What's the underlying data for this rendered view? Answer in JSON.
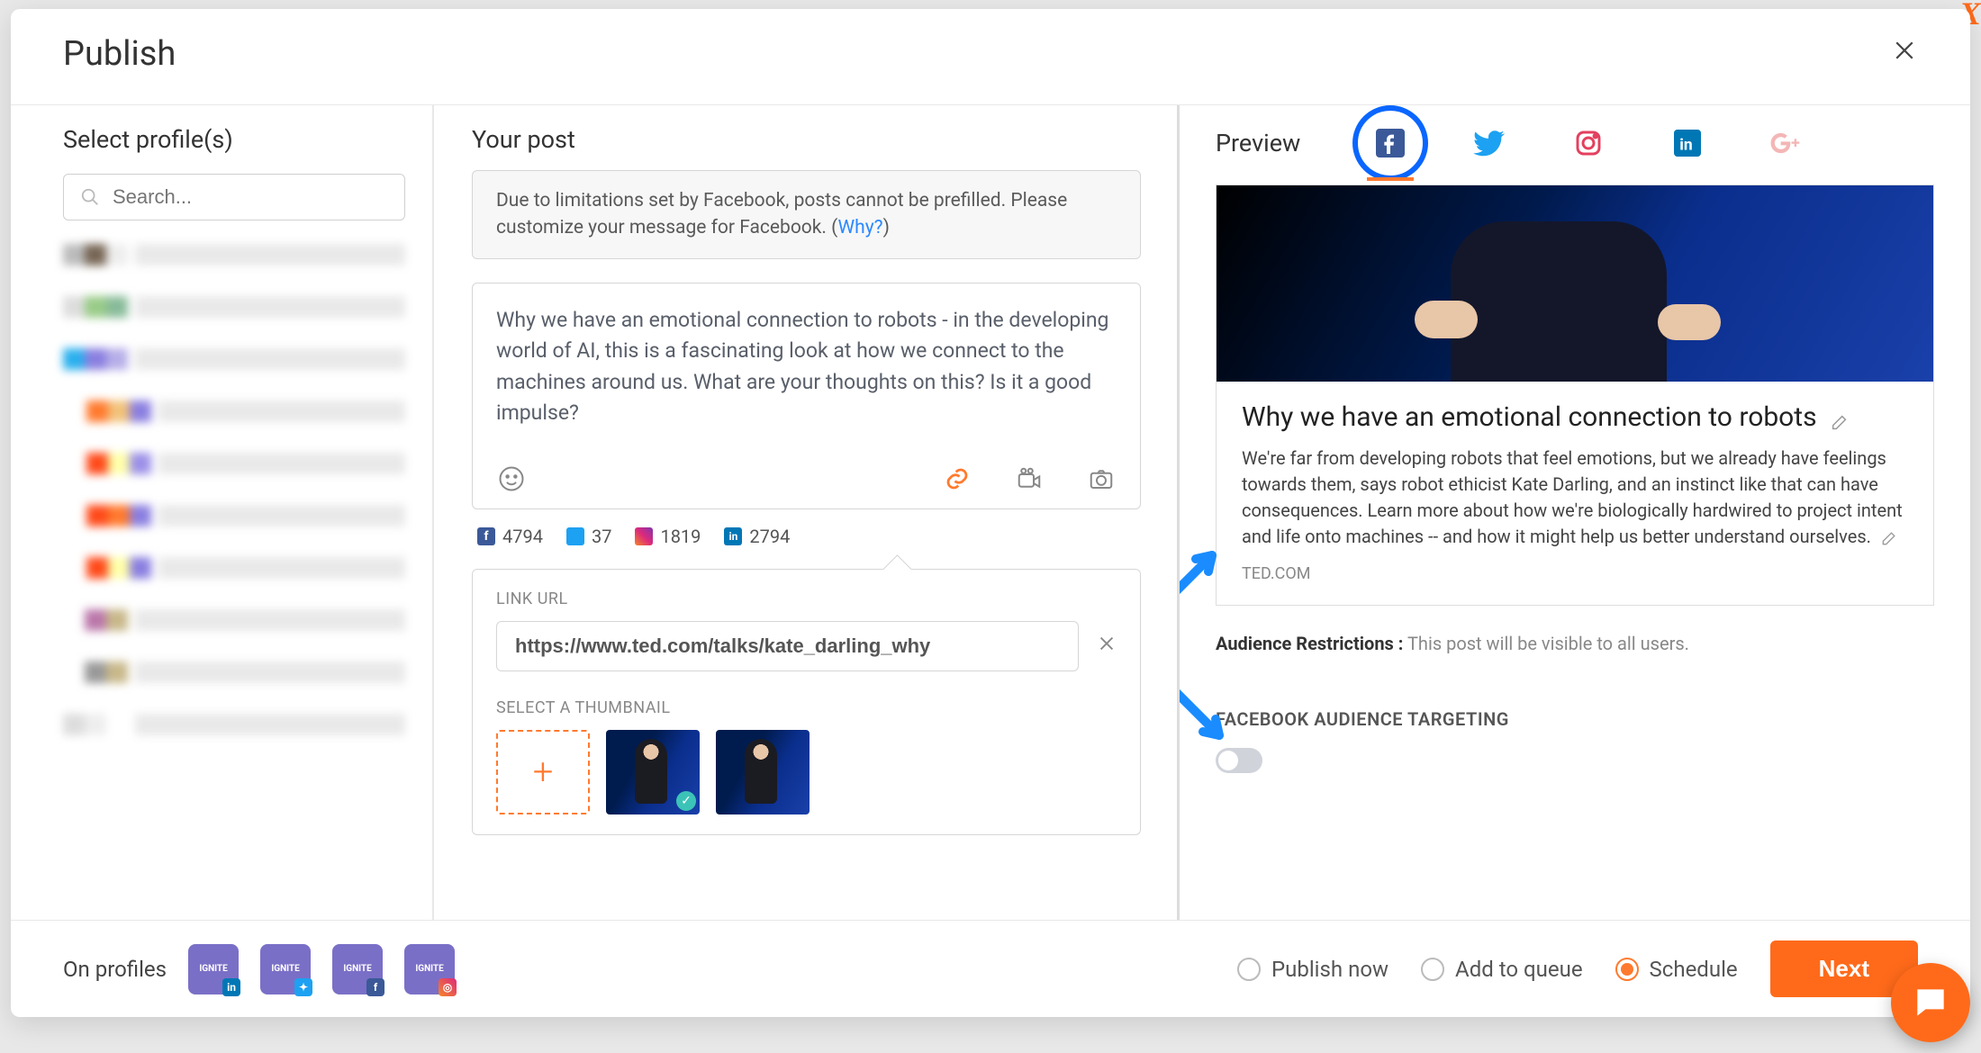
{
  "header": {
    "title": "Publish"
  },
  "left": {
    "heading": "Select profile(s)",
    "search_placeholder": "Search..."
  },
  "mid": {
    "heading": "Your post",
    "notice_text": "Due to limitations set by Facebook, posts cannot be prefilled. Please customize your message for Facebook. (",
    "notice_link": "Why?",
    "notice_close": ")",
    "post_text": "Why we have an emotional connection to robots - in the developing world of AI, this is a fascinating look at how we connect to the machines around us. What are your thoughts on  this? Is it a good impulse?",
    "counts": {
      "facebook": "4794",
      "twitter": "37",
      "instagram": "1819",
      "linkedin": "2794"
    },
    "link_label": "LINK URL",
    "link_url": "https://www.ted.com/talks/kate_darling_why",
    "thumb_label": "SELECT A THUMBNAIL"
  },
  "right": {
    "heading": "Preview",
    "card_title": "Why we have an emotional connection to robots",
    "card_desc": "We're far from developing robots that feel emotions, but we already have feelings towards them, says robot ethicist Kate Darling, and an instinct like that can have consequences. Learn more about how we're biologically hardwired to project intent and life onto machines -- and how it might help us better understand ourselves.",
    "card_domain": "TED.COM",
    "aud_label": "Audience Restrictions :",
    "aud_value": "This post will be visible to all users.",
    "targeting_heading": "FACEBOOK AUDIENCE TARGETING"
  },
  "footer": {
    "on_profiles": "On profiles",
    "opt_publish": "Publish now",
    "opt_queue": "Add to queue",
    "opt_schedule": "Schedule",
    "next": "Next"
  },
  "colors": {
    "accent": "#ff6a1a",
    "fb": "#3b5998",
    "tw": "#1da1f2",
    "ig": "#e4405f",
    "li": "#0077b5",
    "gp": "#f4b6b6"
  }
}
